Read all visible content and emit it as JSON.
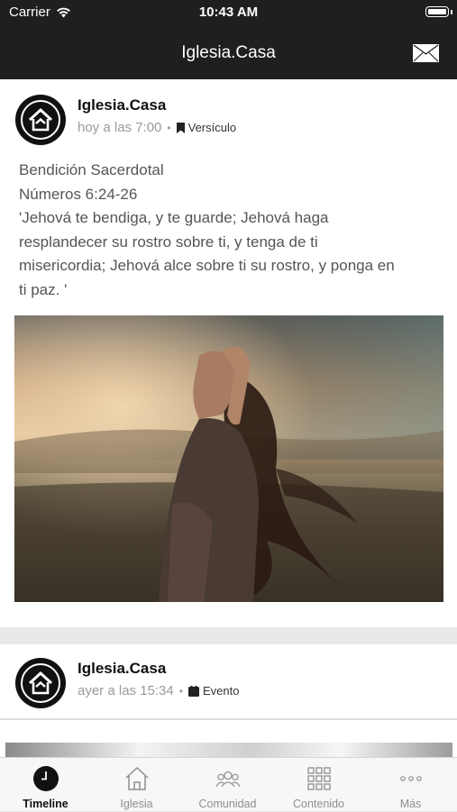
{
  "status_bar": {
    "carrier": "Carrier",
    "time": "10:43 AM"
  },
  "nav": {
    "title": "Iglesia.Casa",
    "mail_icon": "envelope-icon"
  },
  "posts": [
    {
      "author": "Iglesia.Casa",
      "time": "hoy a las 7:00",
      "separator": "•",
      "tag": "Versículo",
      "tag_icon": "bookmark-icon",
      "text_lines": [
        "Bendición Sacerdotal",
        "Números 6:24-26",
        "'Jehová te bendiga, y te guarde; Jehová haga",
        "resplandecer su rostro sobre ti, y tenga de ti",
        "misericordia; Jehová alce sobre ti su rostro, y ponga en",
        "ti paz. '"
      ],
      "image": "woman-in-wind-photo"
    },
    {
      "author": "Iglesia.Casa",
      "time": "ayer a las 15:34",
      "separator": "•",
      "tag": "Evento",
      "tag_icon": "calendar-icon"
    }
  ],
  "tabs": [
    {
      "label": "Timeline",
      "icon": "clock-icon",
      "active": true
    },
    {
      "label": "Iglesia",
      "icon": "church-icon",
      "active": false
    },
    {
      "label": "Comunidad",
      "icon": "people-icon",
      "active": false
    },
    {
      "label": "Contenido",
      "icon": "grid-icon",
      "active": false
    },
    {
      "label": "Más",
      "icon": "more-icon",
      "active": false
    }
  ],
  "colors": {
    "bar": "#1f1f1f",
    "background": "#e9e9eb",
    "card": "#ffffff",
    "muted_text": "#9a9a9a"
  }
}
